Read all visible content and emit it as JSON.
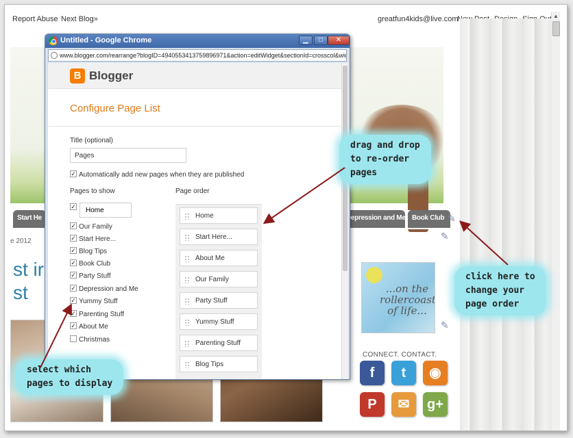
{
  "navbar": {
    "report_abuse": "Report Abuse",
    "next_blog": "Next Blog»",
    "email": "greatfun4kids@live.com",
    "new_post": "New Post",
    "design": "Design",
    "sign_out": "Sign Out"
  },
  "blog": {
    "tabs": [
      "Start He",
      "Depression and Me",
      "Book Club"
    ],
    "date": "e 2012",
    "post_title_1": "st ir",
    "post_title_2": "st",
    "sidebar_image_text": "...on the rollercoaster of life...",
    "connect_heading": "CONNECT. CONTACT."
  },
  "popup": {
    "window_title": "Untitled - Google Chrome",
    "url": "www.blogger.com/rearrange?blogID=4940553413759896971&action=editWidget&sectionId=crosscol&widgetTy",
    "blogger_name": "Blogger",
    "heading": "Configure Page List",
    "title_label": "Title (optional)",
    "title_value": "Pages",
    "auto_add_label": "Automatically add new pages when they are published",
    "pages_to_show_label": "Pages to show",
    "page_order_label": "Page order",
    "home_field": "Home",
    "pages_to_show": [
      {
        "label": "Our Family",
        "checked": true
      },
      {
        "label": "Start Here...",
        "checked": true
      },
      {
        "label": "Blog Tips",
        "checked": true
      },
      {
        "label": "Book Club",
        "checked": true
      },
      {
        "label": "Party Stuff",
        "checked": true
      },
      {
        "label": "Depression and Me",
        "checked": true
      },
      {
        "label": "Yummy Stuff",
        "checked": true
      },
      {
        "label": "Parenting Stuff",
        "checked": true
      },
      {
        "label": "About Me",
        "checked": true
      },
      {
        "label": "Christmas",
        "checked": false
      }
    ],
    "page_order": [
      "Home",
      "Start Here...",
      "About Me",
      "Our Family",
      "Party Stuff",
      "Yummy Stuff",
      "Parenting Stuff",
      "Blog Tips"
    ]
  },
  "annotations": {
    "drag_drop": [
      "drag and drop",
      "to re-order",
      "pages"
    ],
    "click_here": [
      "click here to",
      "change your",
      "page order"
    ],
    "select_which": [
      "select which",
      "pages to display"
    ]
  },
  "colors": {
    "blogger_orange": "#f57d00",
    "heading_orange": "#dd7a17",
    "callout_cyan": "#9de6ee",
    "arrow": "#8b1a1a",
    "tab_gray": "#6f6f6f"
  }
}
